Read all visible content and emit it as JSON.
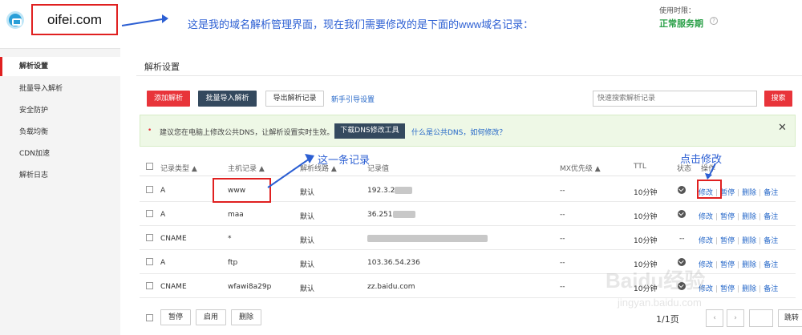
{
  "header": {
    "domain": "oifei.com",
    "annotation": "这是我的域名解析管理界面，现在我们需要修改的是下面的www域名记录：",
    "usage_label": "使用时限：",
    "usage_status": "正常服务期",
    "help_icon": "?"
  },
  "sidebar": {
    "items": [
      {
        "label": "解析设置"
      },
      {
        "label": "批量导入解析"
      },
      {
        "label": "安全防护"
      },
      {
        "label": "负载均衡"
      },
      {
        "label": "CDN加速"
      },
      {
        "label": "解析日志"
      }
    ]
  },
  "main": {
    "title": "解析设置",
    "toolbar": {
      "add_label": "添加解析",
      "import_label": "批量导入解析",
      "export_label": "导出解析记录",
      "guide_link": "新手引导设置",
      "search_placeholder": "快速搜索解析记录",
      "search_button": "搜索"
    },
    "notice": {
      "dot": "•",
      "text": "建议您在电脑上修改公共DNS，让解析设置实时生效。",
      "button": "下载DNS修改工具",
      "link": "什么是公共DNS，如何修改？",
      "close": "✕"
    },
    "table": {
      "headers": {
        "type": "记录类型 ▲",
        "host": "主机记录 ▲",
        "line": "解析线路 ▲",
        "value": "记录值",
        "mx": "MX优先级 ▲",
        "ttl": "TTL",
        "status": "状态",
        "ops": "操作"
      },
      "rows": [
        {
          "type": "A",
          "host": "www",
          "line": "默认",
          "value": "192.3.2",
          "mx": "--",
          "ttl": "10分钟",
          "status": "--"
        },
        {
          "type": "A",
          "host": "maa",
          "line": "默认",
          "value": "36.251",
          "mx": "--",
          "ttl": "10分钟",
          "status": "--"
        },
        {
          "type": "CNAME",
          "host": "*",
          "line": "默认",
          "value": "",
          "mx": "--",
          "ttl": "10分钟",
          "status": "--"
        },
        {
          "type": "A",
          "host": "ftp",
          "line": "默认",
          "value": "103.36.54.236",
          "mx": "--",
          "ttl": "10分钟",
          "status": "--"
        },
        {
          "type": "CNAME",
          "host": "wfawi8a29p",
          "line": "默认",
          "value": "zz.baidu.com",
          "mx": "--",
          "ttl": "10分钟",
          "status": "--"
        }
      ],
      "ops": {
        "edit": "修改",
        "pause": "暂停",
        "delete": "删除",
        "note": "备注"
      }
    },
    "footer": {
      "pause": "暂停",
      "enable": "启用",
      "delete": "删除",
      "page": "1/1页",
      "jump": "跳转"
    },
    "annotations": {
      "record": "这一条记录",
      "click_edit": "点击修改"
    },
    "watermark": "Baidu经验",
    "watermark_sub": "jingyan.baidu.com"
  },
  "colors": {
    "accent_red": "#e8343a",
    "dark_button": "#34495e",
    "link_blue": "#2366c8",
    "status_green": "#2da14a",
    "annotation_blue": "#2c5fd3"
  },
  "icons": {
    "logo": "dns-logo-icon",
    "status": "shield-check-icon",
    "close": "close-icon",
    "help": "help-circle-icon",
    "arrow": "annotation-arrow-icon"
  }
}
